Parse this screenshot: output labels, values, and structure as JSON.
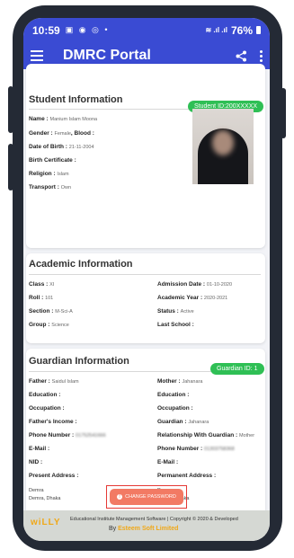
{
  "status_bar": {
    "time": "10:59",
    "icons": "▣ ◉ ◎ •",
    "signal": "≋ .ıl .ıl",
    "battery": "76%"
  },
  "app_bar": {
    "title": "DMRC Portal"
  },
  "student": {
    "section_title": "Student Information",
    "badge": "Student ID:200XXXXX",
    "name_label": "Name :",
    "name_value": "Manium Islam Moona",
    "gender_label": "Gender :",
    "gender_value": "Female",
    "blood_label": ", Blood :",
    "dob_label": "Date of Birth :",
    "dob_value": "21-11-2004",
    "birth_cert_label": "Birth Certificate :",
    "religion_label": "Religion :",
    "religion_value": "Islam",
    "transport_label": "Transport :",
    "transport_value": "Own"
  },
  "academic": {
    "section_title": "Academic Information",
    "class_label": "Class :",
    "class_value": "XI",
    "admission_label": "Admission Date :",
    "admission_value": "01-10-2020",
    "roll_label": "Roll :",
    "roll_value": "101",
    "year_label": "Academic Year :",
    "year_value": "2020-2021",
    "section_label": "Section :",
    "section_value": "M-Sci-A",
    "status_label": "Status :",
    "status_value": "Active",
    "group_label": "Group :",
    "group_value": "Science",
    "last_school_label": "Last School :"
  },
  "guardian": {
    "section_title": "Guardian Information",
    "badge": "Guardian ID: 1",
    "father_label": "Father :",
    "father_value": "Saidul Islam",
    "mother_label": "Mother :",
    "mother_value": "Jahanara",
    "education_label": "Education :",
    "occupation_label": "Occupation :",
    "income_label": "Father's Income :",
    "guardian_label": "Guardian :",
    "guardian_value": "Jahanara",
    "phone_label": "Phone Number :",
    "father_phone": "01752541666",
    "relationship_label": "Relationship With Guardian :",
    "relationship_value": "Mother",
    "mother_phone": "01303758368",
    "email_label": "E-Mail :",
    "nid_label": "NID :",
    "present_address_label": "Present Address :",
    "permanent_address_label": "Permanent Address :",
    "present_address_line1": "Demra",
    "present_address_line2": "Demra, Dhaka",
    "permanent_address_line1": "Demra",
    "permanent_address_line2": "Demra, Dhaka"
  },
  "change_password_label": "CHANGE PASSWORD",
  "footer": {
    "logo": "wiLLY",
    "line1": "Educational Institute Management Software | Copyright © 2020 & Developed",
    "by_label": "By",
    "brand": "Esteem Soft Limited"
  },
  "colors": {
    "primary": "#3a4bd3",
    "badge_green": "#2fbf55",
    "button": "#f27a64",
    "brand_orange": "#f0a818"
  }
}
